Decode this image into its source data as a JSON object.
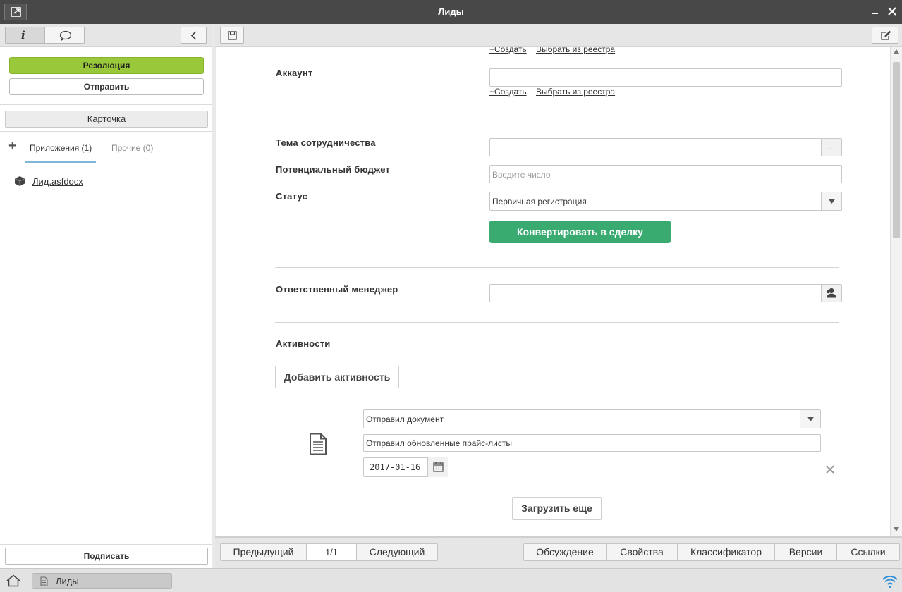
{
  "window": {
    "title": "Лиды"
  },
  "left": {
    "resolution_label": "Резолюция",
    "send_label": "Отправить",
    "card_label": "Карточка",
    "tabs": [
      {
        "label": "Приложения (1)"
      },
      {
        "label": "Прочие (0)"
      }
    ],
    "files": [
      {
        "name": "Лид.asfdocx"
      }
    ],
    "sign_label": "Подписать"
  },
  "form": {
    "top_links": {
      "create": "+Создать",
      "select": "Выбрать из реестра"
    },
    "account": {
      "label": "Аккаунт",
      "value": "",
      "create": "+Создать",
      "select": "Выбрать из реестра"
    },
    "topic": {
      "label": "Тема сотрудничества",
      "value": "",
      "button": "…"
    },
    "budget": {
      "label": "Потенциальный бюджет",
      "placeholder": "Введите число"
    },
    "status": {
      "label": "Статус",
      "value": "Первичная регистрация"
    },
    "convert_label": "Конвертировать в сделку",
    "manager": {
      "label": "Ответственный менеджер",
      "value": ""
    },
    "activities": {
      "label": "Активности",
      "add_label": "Добавить активность",
      "item": {
        "type": "Отправил документ",
        "description": "Отправил обновленные прайс-листы",
        "date": "2017-01-16"
      },
      "load_more": "Загрузить еще"
    }
  },
  "bottom": {
    "prev": "Предыдущий",
    "page": "1/1",
    "next": "Следующий",
    "tabs": [
      "Обсуждение",
      "Свойства",
      "Классификатор",
      "Версии",
      "Ссылки"
    ]
  },
  "taskbar": {
    "task_label": "Лиды"
  },
  "colors": {
    "resolution": "#99c93a",
    "convert": "#3aab70",
    "tab_underline": "#7fb7d6",
    "titlebar": "#484848"
  }
}
